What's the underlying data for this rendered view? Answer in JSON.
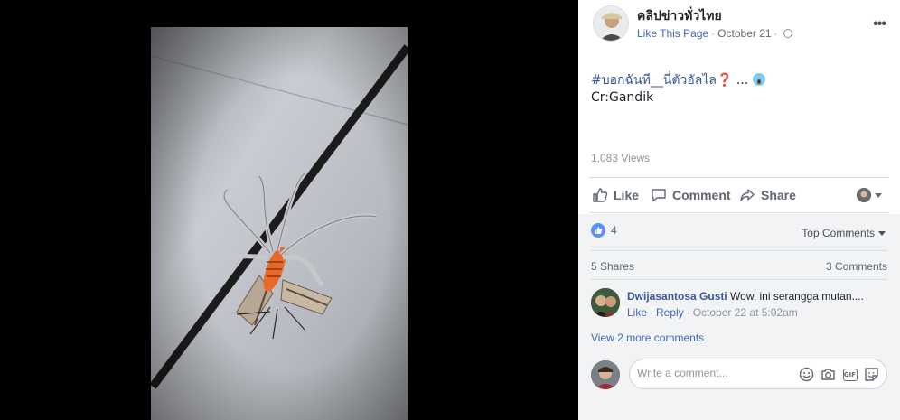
{
  "page": {
    "name": "คลิปข่าวทั่วไทย",
    "like_link": "Like This Page",
    "separator": "·",
    "date": "October 21",
    "privacy_icon": "globe-icon",
    "more_icon": "more-options-icon"
  },
  "post": {
    "hashtag": "#บอกฉันที__นี่ตัวอัลไล",
    "hashtag_emoji": "❓",
    "ellipsis": " ... ",
    "emoji": "scream-face-icon",
    "credit": "Cr:Gandik",
    "views": "1,083 Views"
  },
  "actions": {
    "like": "Like",
    "comment": "Comment",
    "share": "Share"
  },
  "reactions": {
    "count": "4",
    "sort_label": "Top Comments"
  },
  "stats": {
    "shares": "5 Shares",
    "comments": "3 Comments"
  },
  "comment": {
    "author": "Dwijasantosa Gusti",
    "text": "Wow, ini serangga mutan....",
    "like": "Like",
    "reply": "Reply",
    "dot": "·",
    "time": "October 22 at 5:02am"
  },
  "view_more": "View 2 more comments",
  "composer": {
    "placeholder": "Write a comment...",
    "tools": [
      "emoji-icon",
      "camera-icon",
      "gif-icon",
      "sticker-icon"
    ]
  },
  "colors": {
    "link": "#4267b2",
    "panel_bg": "#ffffff",
    "comments_bg": "#f2f3f5",
    "like_badge": "#5890ff"
  }
}
